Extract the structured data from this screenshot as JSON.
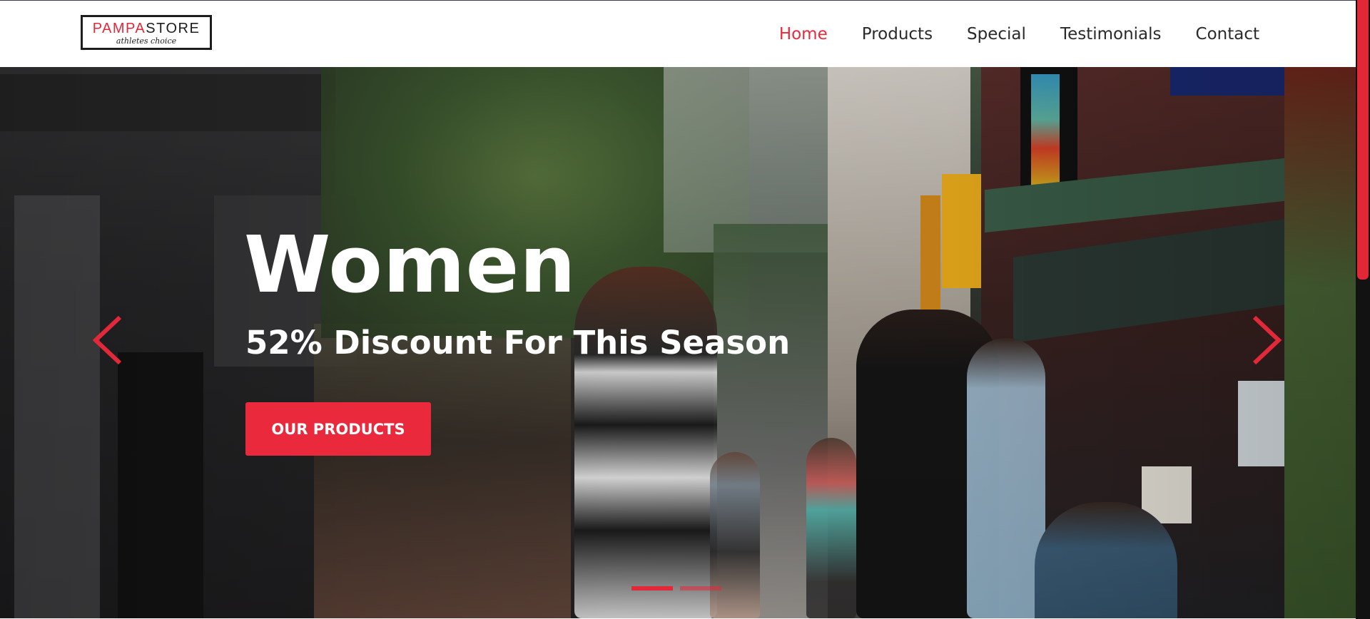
{
  "brand": {
    "logo_part1": "PAMPA",
    "logo_part2": "STORE",
    "tagline": "athletes choice"
  },
  "nav": {
    "items": [
      "Home",
      "Products",
      "Special",
      "Testimonials",
      "Contact"
    ],
    "active_index": 0
  },
  "hero": {
    "title": "Women",
    "subtitle": "52% Discount For This Season",
    "cta_label": "OUR PRODUCTS",
    "slide_count": 2,
    "active_slide": 0,
    "prev_icon": "chevron-left-icon",
    "next_icon": "chevron-right-icon"
  },
  "colors": {
    "accent": "#ea2a3c",
    "text_dark": "#2a2a2a",
    "white": "#ffffff"
  }
}
